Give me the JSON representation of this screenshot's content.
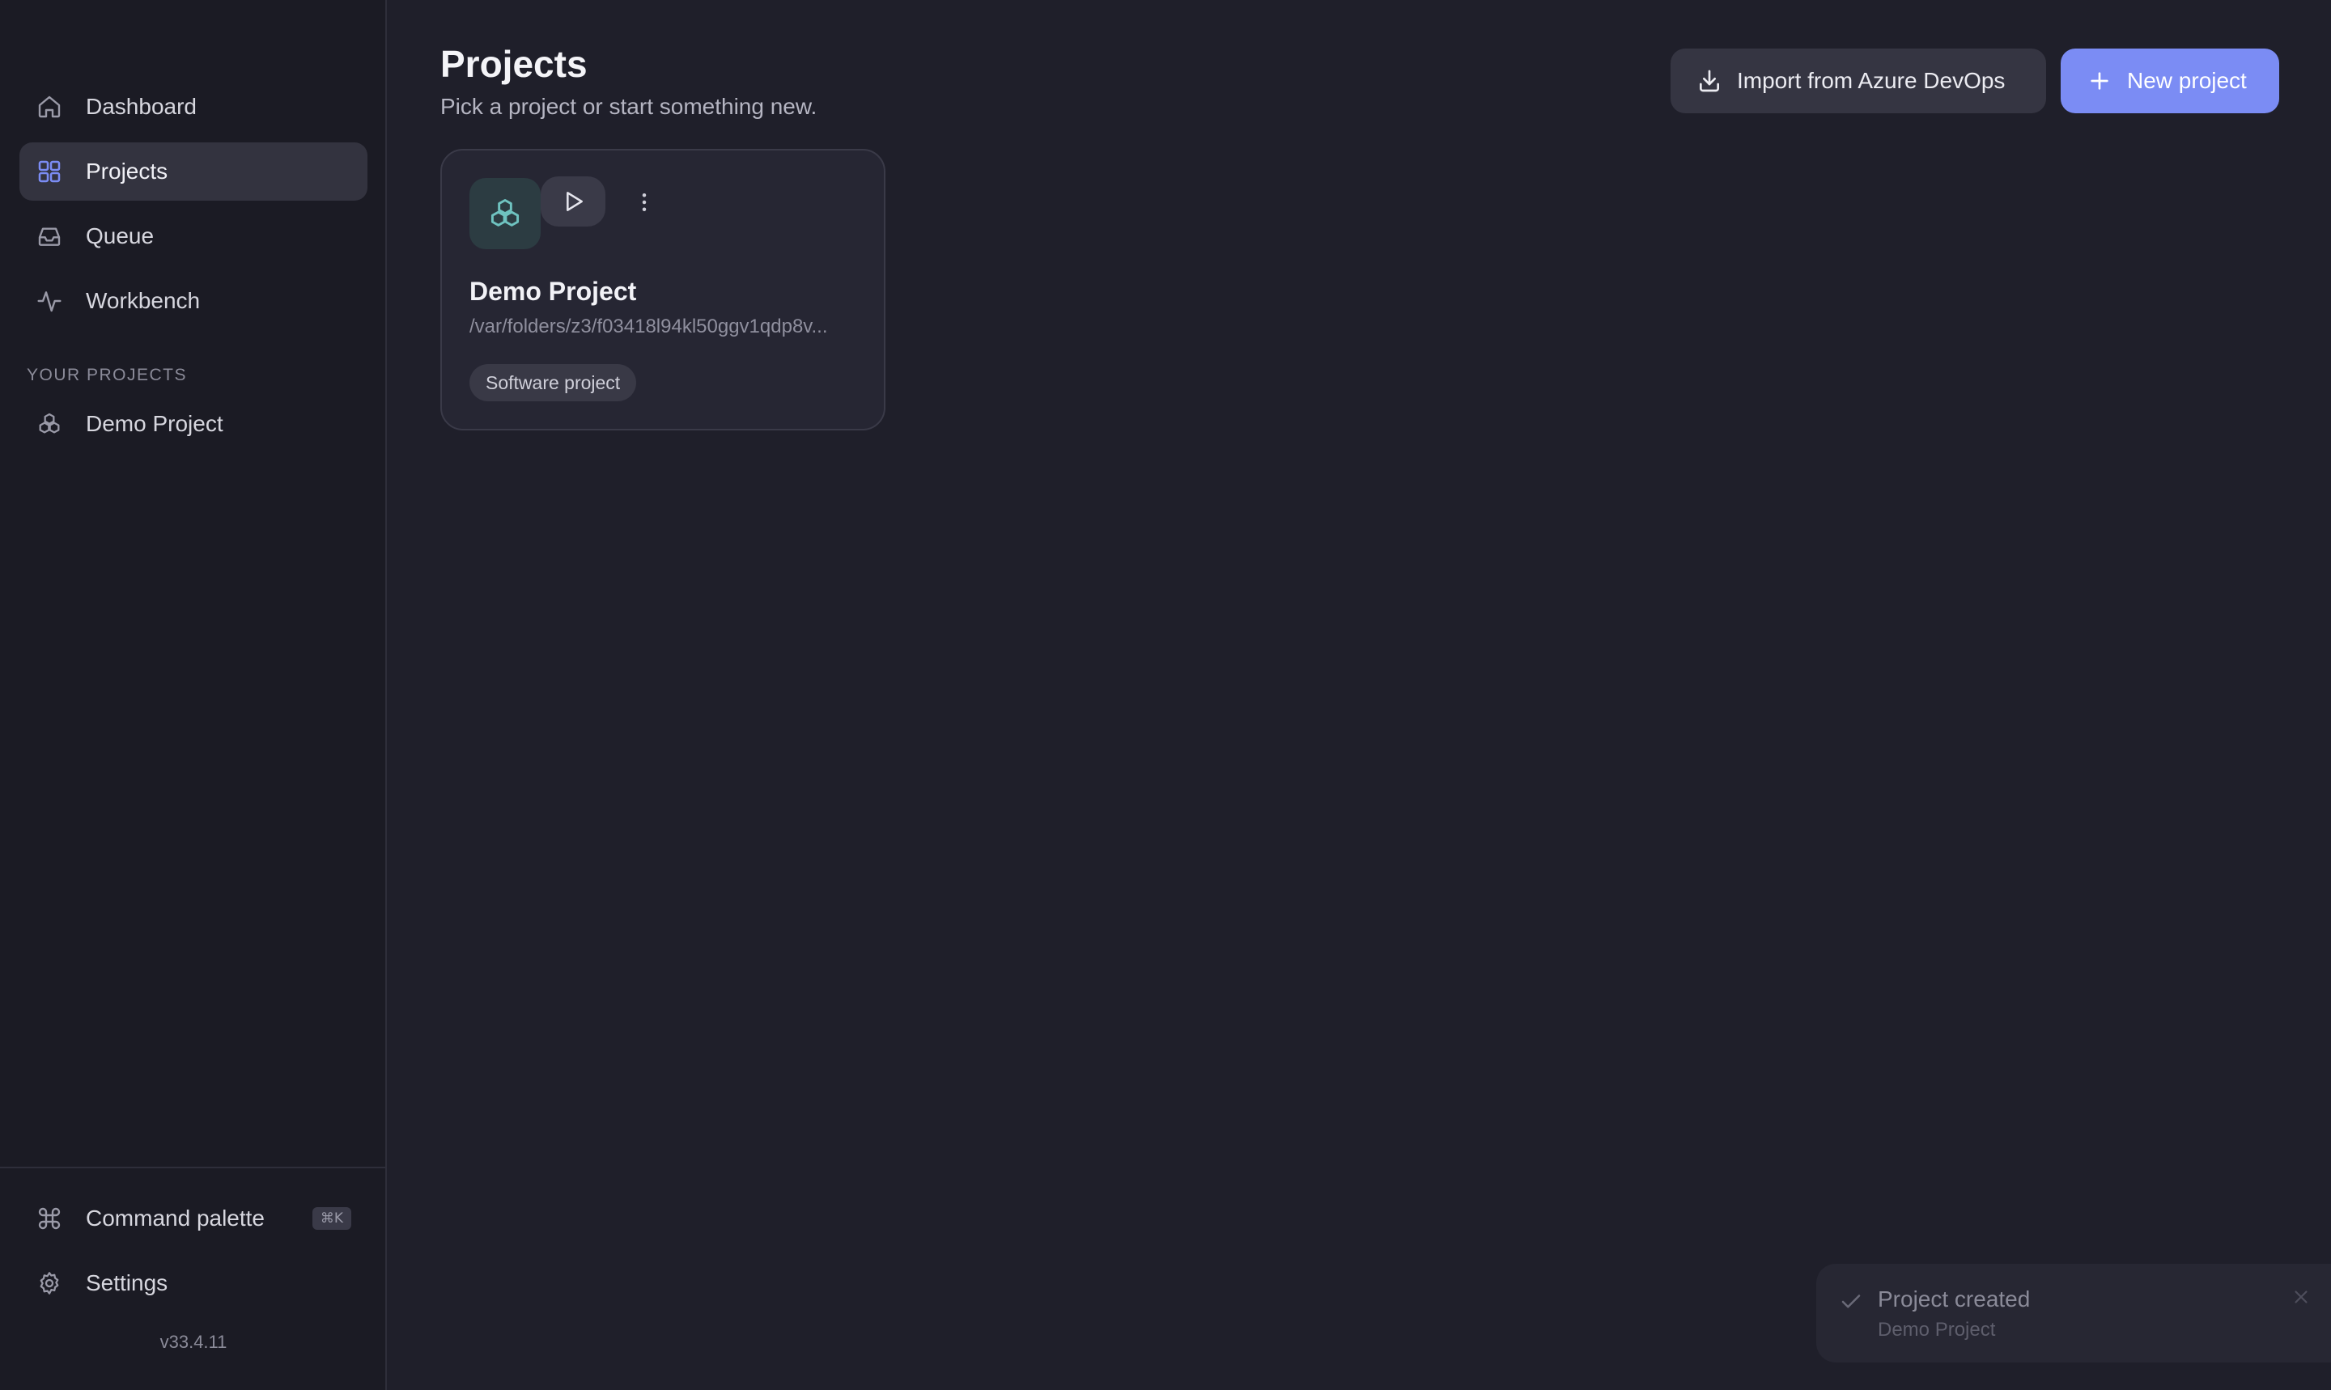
{
  "sidebar": {
    "nav": [
      {
        "label": "Dashboard",
        "icon": "home-icon"
      },
      {
        "label": "Projects",
        "icon": "grid-icon",
        "active": true
      },
      {
        "label": "Queue",
        "icon": "inbox-icon"
      },
      {
        "label": "Workbench",
        "icon": "activity-icon"
      }
    ],
    "section_label": "YOUR PROJECTS",
    "projects": [
      {
        "label": "Demo Project",
        "icon": "cubes-icon"
      }
    ],
    "footer": {
      "command_palette": "Command palette",
      "command_shortcut": "⌘K",
      "settings": "Settings",
      "version": "v33.4.11"
    }
  },
  "header": {
    "title": "Projects",
    "subtitle": "Pick a project or start something new.",
    "import_label": "Import from Azure DevOps",
    "new_label": "New project"
  },
  "projects": [
    {
      "name": "Demo Project",
      "path": "/var/folders/z3/f03418l94kl50ggv1qdp8v...",
      "tag": "Software project"
    }
  ],
  "toast": {
    "title": "Project created",
    "description": "Demo Project"
  },
  "colors": {
    "background": "#1f1f2a",
    "sidebar": "#1b1b24",
    "accent": "#7b8cf4",
    "project_icon": "#6fc3c0"
  }
}
